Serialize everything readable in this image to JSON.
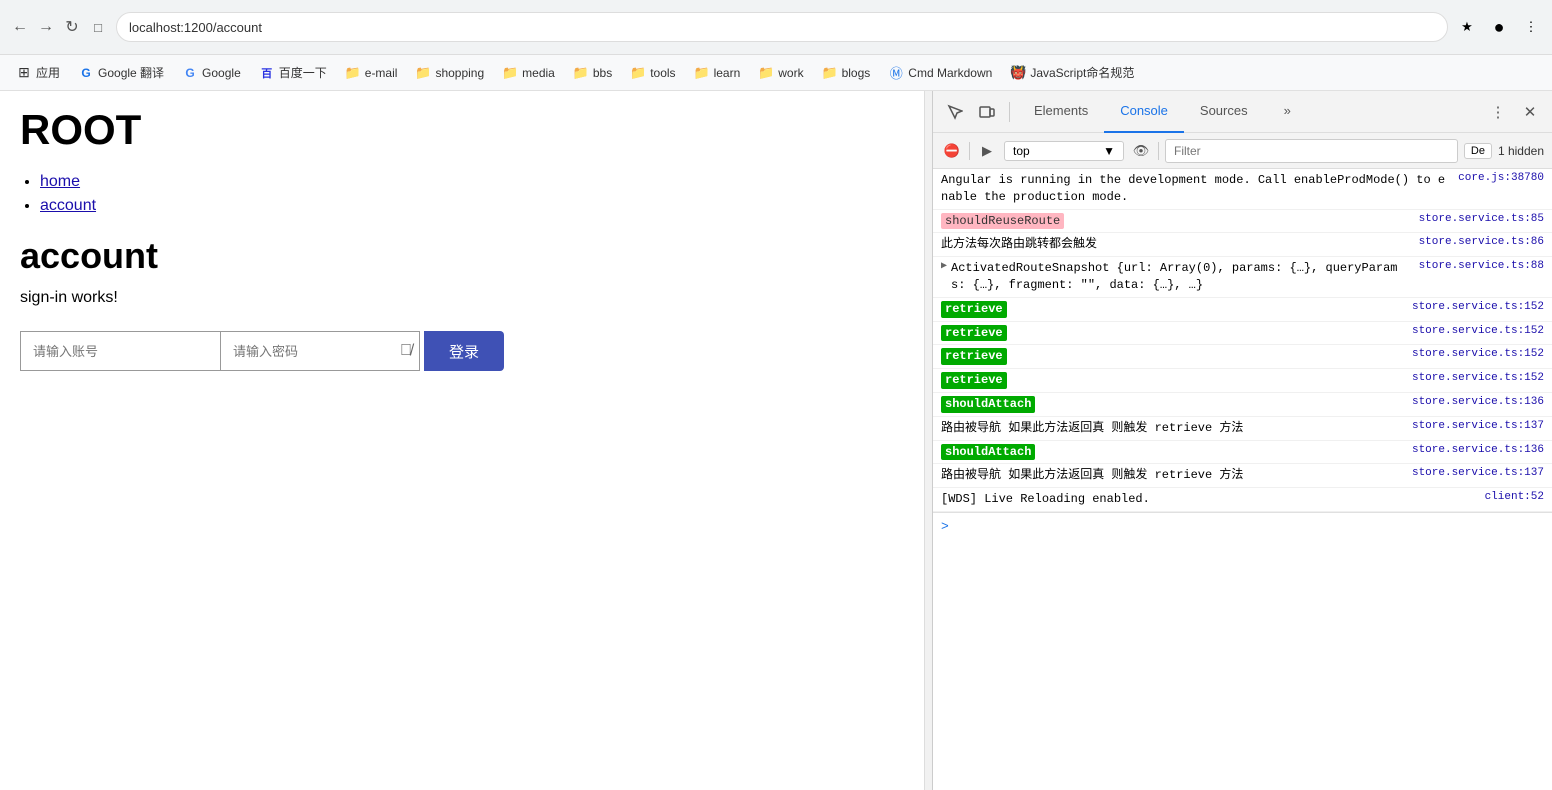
{
  "browser": {
    "address": "localhost:1200/account",
    "nav_back": "←",
    "nav_forward": "→",
    "nav_refresh": "↻",
    "nav_home": "⌂"
  },
  "bookmarks": [
    {
      "id": "apps",
      "label": "应用",
      "icon": "⊞",
      "type": "apps"
    },
    {
      "id": "google-translate",
      "label": "Google 翻译",
      "icon": "G",
      "type": "google"
    },
    {
      "id": "google",
      "label": "Google",
      "icon": "G",
      "type": "google2"
    },
    {
      "id": "baidu",
      "label": "百度一下",
      "icon": "百",
      "type": "baidu"
    },
    {
      "id": "email",
      "label": "e-mail",
      "icon": "📁",
      "type": "folder"
    },
    {
      "id": "shopping",
      "label": "shopping",
      "icon": "📁",
      "type": "folder"
    },
    {
      "id": "media",
      "label": "media",
      "icon": "📁",
      "type": "folder"
    },
    {
      "id": "bbs",
      "label": "bbs",
      "icon": "📁",
      "type": "folder"
    },
    {
      "id": "tools",
      "label": "tools",
      "icon": "📁",
      "type": "folder"
    },
    {
      "id": "learn",
      "label": "learn",
      "icon": "📁",
      "type": "folder"
    },
    {
      "id": "work",
      "label": "work",
      "icon": "📁",
      "type": "folder"
    },
    {
      "id": "blogs",
      "label": "blogs",
      "icon": "📁",
      "type": "folder"
    },
    {
      "id": "cmd-markdown",
      "label": "Cmd Markdown",
      "icon": "Ⓜ",
      "type": "cmd"
    },
    {
      "id": "js-naming",
      "label": "JavaScript命名规范",
      "icon": "🐙",
      "type": "github"
    }
  ],
  "page": {
    "title": "ROOT",
    "nav_items": [
      {
        "label": "home",
        "href": "#"
      },
      {
        "label": "account",
        "href": "#"
      }
    ],
    "section_title": "account",
    "signin_text": "sign-in works!",
    "username_placeholder": "请输入账号",
    "password_placeholder": "请输入密码",
    "login_button": "登录"
  },
  "devtools": {
    "tabs": [
      {
        "id": "elements",
        "label": "Elements",
        "active": false
      },
      {
        "id": "console",
        "label": "Console",
        "active": true
      },
      {
        "id": "sources",
        "label": "Sources",
        "active": false
      },
      {
        "id": "more",
        "label": "»",
        "active": false
      }
    ],
    "console_toolbar": {
      "top_selector": "top",
      "filter_placeholder": "Filter",
      "default_label": "De",
      "hidden_count": "1 hidden"
    },
    "console_entries": [
      {
        "id": "angular-msg",
        "text": "Angular is running in the development mode. Call enableProdMode() to enable the production mode.",
        "link": "core.js:38780",
        "type": "normal",
        "badge": null
      },
      {
        "id": "should-reuse-route",
        "text": "shouldReuseRoute",
        "link": "store.service.ts:85",
        "type": "badge-pink",
        "badge": "shouldReuseRoute"
      },
      {
        "id": "method-trigger",
        "text": "此方法每次路由跳转都会触发",
        "link": "store.service.ts:86",
        "type": "normal",
        "badge": null
      },
      {
        "id": "activated-route",
        "text": "▶ ActivatedRouteSnapshot {url: Array(0), params: {…}, queryParams: {…}, fragment: \"\", data: {…}, …}",
        "link": "store.service.ts:88",
        "type": "normal",
        "badge": null,
        "has_arrow": true
      },
      {
        "id": "retrieve-1",
        "text": "retrieve",
        "link": "store.service.ts:152",
        "type": "badge-green",
        "badge": "retrieve"
      },
      {
        "id": "retrieve-2",
        "text": "retrieve",
        "link": "store.service.ts:152",
        "type": "badge-green",
        "badge": "retrieve"
      },
      {
        "id": "retrieve-3",
        "text": "retrieve",
        "link": "store.service.ts:152",
        "type": "badge-green",
        "badge": "retrieve"
      },
      {
        "id": "retrieve-4",
        "text": "retrieve",
        "link": "store.service.ts:152",
        "type": "badge-green",
        "badge": "retrieve"
      },
      {
        "id": "should-attach-1",
        "text": "shouldAttach",
        "link": "store.service.ts:136",
        "type": "badge-green",
        "badge": "shouldAttach"
      },
      {
        "id": "should-attach-msg-1",
        "text": "路由被导航 如果此方法返回真 则触发 retrieve 方法",
        "link": "store.service.ts:137",
        "type": "normal"
      },
      {
        "id": "should-attach-2",
        "text": "shouldAttach",
        "link": "store.service.ts:136",
        "type": "badge-green",
        "badge": "shouldAttach"
      },
      {
        "id": "should-attach-msg-2",
        "text": "路由被导航 如果此方法返回真 则触发 retrieve 方法",
        "link": "store.service.ts:137",
        "type": "normal"
      },
      {
        "id": "wds-msg",
        "text": "[WDS] Live Reloading enabled.",
        "link": "client:52",
        "type": "normal"
      }
    ],
    "prompt_symbol": ">"
  }
}
